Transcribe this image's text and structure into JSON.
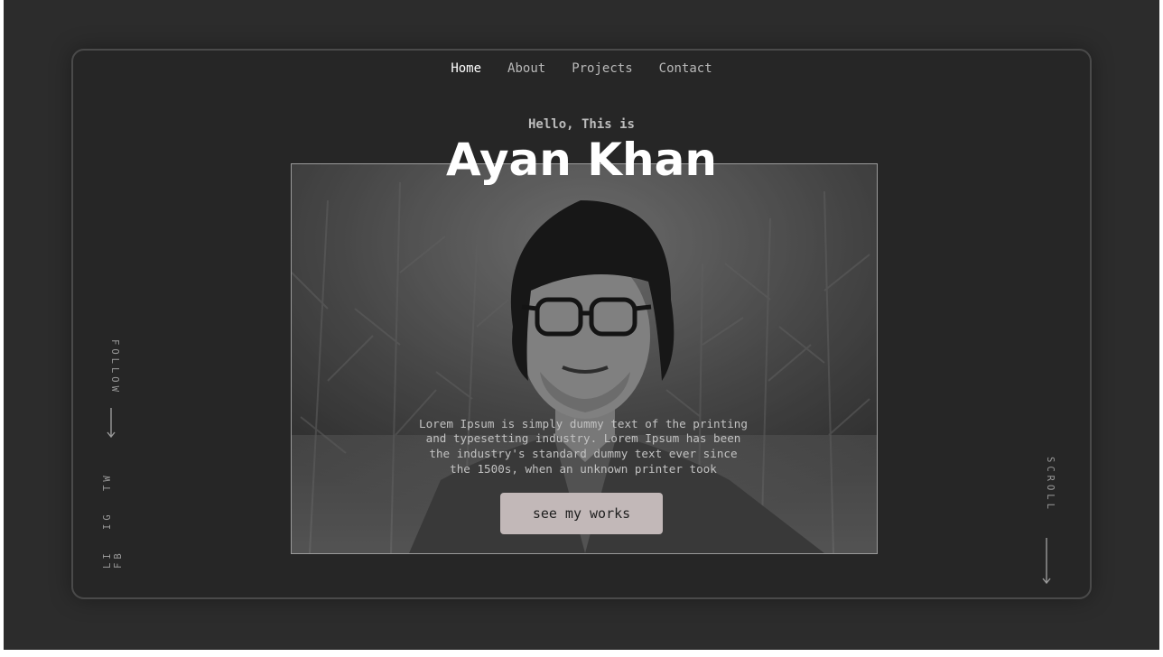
{
  "nav": {
    "items": [
      {
        "label": "Home",
        "active": true
      },
      {
        "label": "About",
        "active": false
      },
      {
        "label": "Projects",
        "active": false
      },
      {
        "label": "Contact",
        "active": false
      }
    ]
  },
  "hero": {
    "greeting": "Hello, This is",
    "name": "Ayan Khan",
    "description": "Lorem Ipsum is simply dummy text of the printing and typesetting industry. Lorem Ipsum has been the industry's standard dummy text ever since the 1500s, when an unknown printer took",
    "cta_label": "see my works"
  },
  "social": {
    "follow_label": "FOLLOW",
    "links": [
      "LI",
      "IG",
      "TW",
      "FB"
    ]
  },
  "scroll": {
    "label": "SCROLL"
  },
  "colors": {
    "background": "#2c2c2c",
    "frame": "#262626",
    "button": "#c2b8b8",
    "text_primary": "#ffffff",
    "text_muted": "#b9b9b9"
  },
  "icons": {
    "follow_arrow": "arrow-down-icon",
    "scroll_arrow": "arrow-down-icon"
  }
}
